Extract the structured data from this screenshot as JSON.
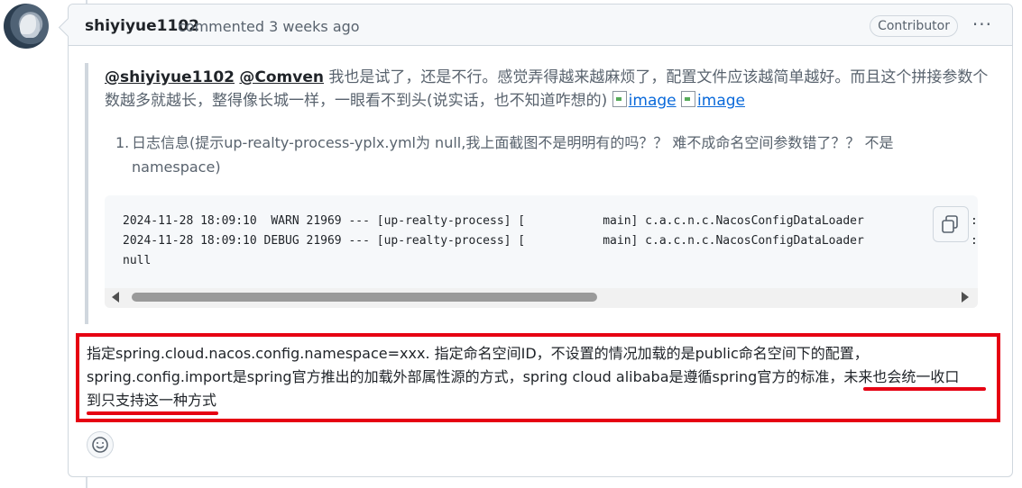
{
  "comment": {
    "author": "shiyiyue1102",
    "meta": "commented 3 weeks ago",
    "badge": "Contributor",
    "menu_label": "···",
    "quote": {
      "mention1": "@shiyiyue1102",
      "mention2": "@Comven",
      "text": " 我也是试了，还是不行。感觉弄得越来越麻烦了，配置文件应该越简单越好。而且这个拼接参数个数越多就越长，整得像长城一样，一眼看不到头(说实话，也不知道咋想的) ",
      "image1": "image",
      "image2": "image",
      "list_number": "1.",
      "list_text": "日志信息(提示up-realty-process-yplx.yml为 null,我上面截图不是明明有的吗？？ 难不成命名空间参数错了？？ 不是namespace)"
    },
    "code": {
      "line1": "2024-11-28 18:09:10  WARN 21969 --- [up-realty-process] [           main] c.a.c.n.c.NacosConfigDataLoader",
      "line2": "2024-11-28 18:09:10 DEBUG 21969 --- [up-realty-process] [           main] c.a.c.n.c.NacosConfigDataLoader",
      "line3": "null",
      "cut1": ":",
      "cut2": ":"
    },
    "answer": {
      "line1": "指定spring.cloud.nacos.config.namespace=xxx. 指定命名空间ID，不设置的情况加载的是public命名空间下的配置，",
      "line2": "spring.config.import是spring官方推出的加载外部属性源的方式，spring cloud alibaba是遵循spring官方的标准，未来也会统一收口",
      "line3": "到只支持这一种方式"
    }
  },
  "colors": {
    "highlight": "#e60012",
    "link": "#0969da",
    "muted": "#59636e"
  }
}
